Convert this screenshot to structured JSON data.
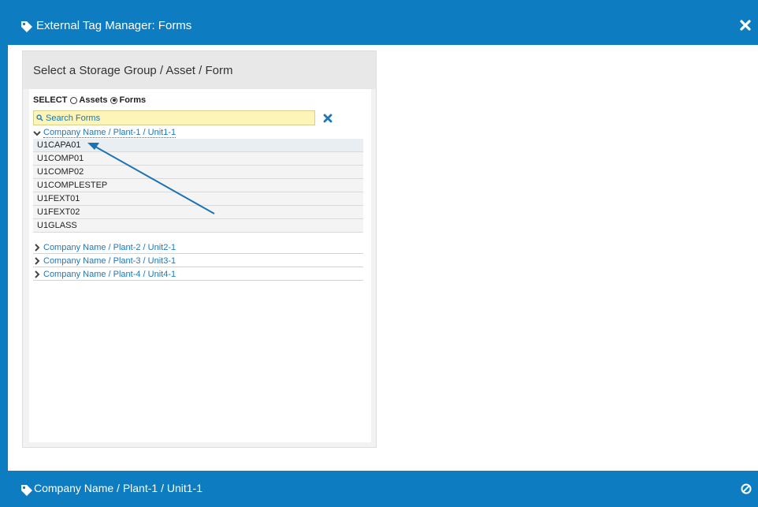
{
  "window": {
    "title": "External Tag Manager: Forms"
  },
  "panel": {
    "title": "Select a Storage Group / Asset / Form",
    "select_label": "SELECT",
    "radio_assets": "Assets",
    "radio_forms": "Forms",
    "selected_radio": "Forms"
  },
  "search": {
    "placeholder": "Search Forms",
    "value": ""
  },
  "groups": [
    {
      "label": "Company Name / Plant-1 / Unit1-1",
      "expanded": true,
      "forms": [
        "U1CAPA01",
        "U1COMP01",
        "U1COMP02",
        "U1COMPLESTEP",
        "U1FEXT01",
        "U1FEXT02",
        "U1GLASS"
      ]
    },
    {
      "label": "Company Name / Plant-2 / Unit2-1",
      "expanded": false
    },
    {
      "label": "Company Name / Plant-3 / Unit3-1",
      "expanded": false
    },
    {
      "label": "Company Name / Plant-4 / Unit4-1",
      "expanded": false
    }
  ],
  "footer": {
    "title": "Company Name / Plant-1 / Unit1-1"
  },
  "icons": {
    "title_icon": "tag-icon",
    "close_icon": "close-icon",
    "search_icon": "search-icon",
    "clear_icon": "clear-search-icon",
    "footer_icon": "tag-icon",
    "footer_action_icon": "ban-icon"
  },
  "colors": {
    "brand": "#0d7cc0",
    "link": "#1f77bb",
    "search_bg": "#fdf5b8"
  }
}
